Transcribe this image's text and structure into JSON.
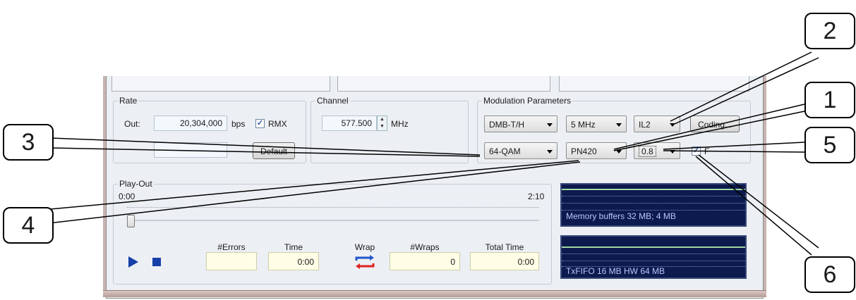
{
  "rate": {
    "legend": "Rate",
    "out_label": "Out:",
    "out_value": "20,304,000",
    "unit": "bps",
    "rmx_label": "RMX",
    "rmx_checked": "✓",
    "default_label": "Default"
  },
  "channel": {
    "legend": "Channel",
    "frequency": "577.500",
    "unit": "MHz"
  },
  "modulation": {
    "legend": "Modulation Parameters",
    "standard": "DMB-T/H",
    "bandwidth": "5 MHz",
    "interleaver": "IL2",
    "coding_label": "Coding...",
    "constellation": "64-QAM",
    "pn_mode": "PN420",
    "code_rate": "0.8",
    "f_label": "F",
    "f_checked": "✓"
  },
  "playout": {
    "legend": "Play-Out",
    "start_time": "0:00",
    "end_time": "2:10",
    "headers": {
      "errors": "#Errors",
      "time": "Time",
      "wrap": "Wrap",
      "wraps": "#Wraps",
      "total_time": "Total Time"
    },
    "values": {
      "errors": "",
      "time": "0:00",
      "wraps": "0",
      "total_time": "0:00"
    },
    "progress": 0
  },
  "monitors": {
    "memory": "Memory buffers 32 MB; 4 MB",
    "fifo": "TxFIFO 16 MB   HW 64 MB"
  },
  "callouts": {
    "c1": "1",
    "c2": "2",
    "c3": "3",
    "c4": "4",
    "c5": "5",
    "c6": "6"
  },
  "icons": {
    "play": "play-icon",
    "stop": "stop-icon",
    "wrap": "wrap-arrows-icon",
    "spin": "spin-updown-icon",
    "dropdown": "chevron-down-icon"
  }
}
